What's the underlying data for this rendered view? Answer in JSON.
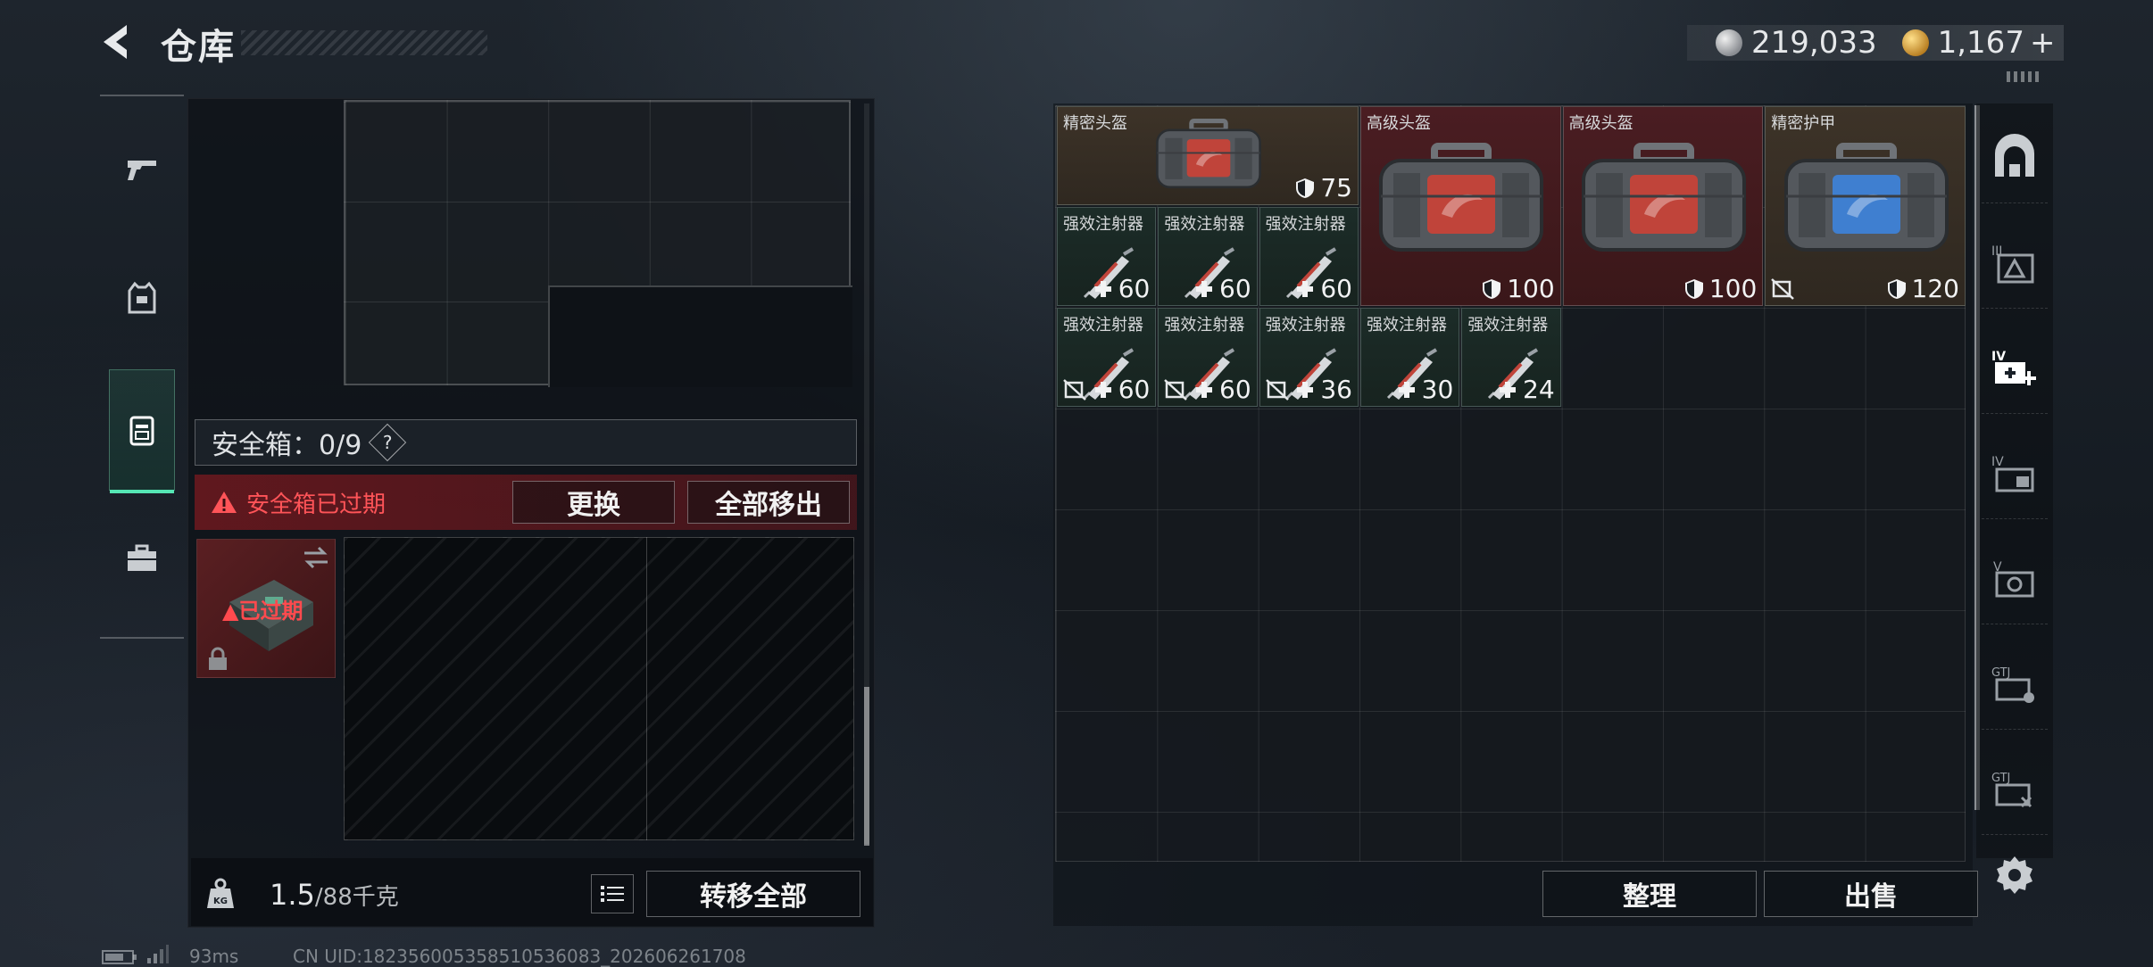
{
  "header": {
    "title": "仓库",
    "currency_silver": "219,033",
    "currency_gold": "1,167",
    "currency_plus": "+"
  },
  "left_panel": {
    "safebox_label": "安全箱：0/9",
    "help": "?",
    "expired_notice": "安全箱已过期",
    "replace_button": "更换",
    "move_all_out_button": "全部移出",
    "card_expired": "已过期",
    "weight_current": "1.5",
    "weight_capacity": "/88千克",
    "transfer_all_button": "转移全部"
  },
  "status": {
    "ping": "93ms",
    "uid": "CN UID:182356005358510536083_202606261708"
  },
  "stash": {
    "items": [
      {
        "name": "精密头盔",
        "value": "75",
        "type": "armor",
        "tint": "brown",
        "bag_color": "#c0443a",
        "no_drop": false
      },
      {
        "name": "高级头盔",
        "value": "100",
        "type": "armor",
        "tint": "red",
        "bag_color": "#c0443a",
        "no_drop": false
      },
      {
        "name": "高级头盔",
        "value": "100",
        "type": "armor",
        "tint": "red",
        "bag_color": "#c0443a",
        "no_drop": false
      },
      {
        "name": "精密护甲",
        "value": "120",
        "type": "armor",
        "tint": "brown",
        "bag_color": "#3f7fd0",
        "no_drop": true
      },
      {
        "name": "强效注射器",
        "value": "60",
        "type": "heal",
        "no_drop": false
      },
      {
        "name": "强效注射器",
        "value": "60",
        "type": "heal",
        "no_drop": false
      },
      {
        "name": "强效注射器",
        "value": "60",
        "type": "heal",
        "no_drop": false
      },
      {
        "name": "强效注射器",
        "value": "60",
        "type": "heal",
        "no_drop": true
      },
      {
        "name": "强效注射器",
        "value": "60",
        "type": "heal",
        "no_drop": true
      },
      {
        "name": "强效注射器",
        "value": "36",
        "type": "heal",
        "no_drop": true
      },
      {
        "name": "强效注射器",
        "value": "30",
        "type": "heal",
        "no_drop": false
      },
      {
        "name": "强效注射器",
        "value": "24",
        "type": "heal",
        "no_drop": false
      }
    ],
    "organize_button": "整理",
    "sell_button": "出售"
  },
  "colors": {
    "accent_green": "#55e6b4",
    "warning_red": "#ff5458"
  },
  "icons": {
    "left_rail": [
      "pistol-icon",
      "vest-icon",
      "backpack-icon",
      "briefcase-icon"
    ],
    "right_rail": [
      "safe-room-icon",
      "armory-icon",
      "medical-icon",
      "workshop-icon",
      "control-center-icon",
      "gtj-icon-1",
      "gtj-icon-2"
    ]
  }
}
